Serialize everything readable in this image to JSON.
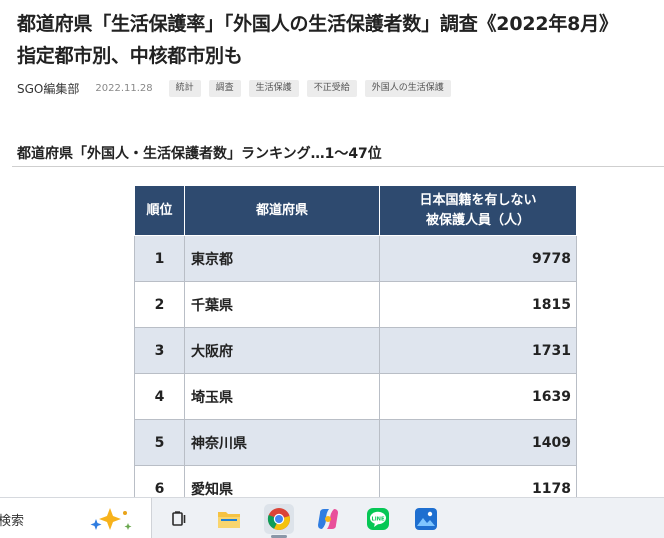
{
  "article": {
    "title_line1": "都道府県「生活保護率」「外国人の生活保護者数」調査《2022年8月》",
    "title_line2": "指定都市別、中核都市別も",
    "author": "SGO編集部",
    "date": "2022.11.28",
    "tags": [
      "統計",
      "調査",
      "生活保護",
      "不正受給",
      "外国人の生活保護"
    ]
  },
  "section": {
    "title": "都道府県「外国人・生活保護者数」ランキング…1〜47位"
  },
  "table": {
    "headers": {
      "rank": "順位",
      "prefecture": "都道府県",
      "count_line1": "日本国籍を有しない",
      "count_line2": "被保護人員（人）"
    },
    "rows": [
      {
        "rank": "1",
        "prefecture": "東京都",
        "count": "9778"
      },
      {
        "rank": "2",
        "prefecture": "千葉県",
        "count": "1815"
      },
      {
        "rank": "3",
        "prefecture": "大阪府",
        "count": "1731"
      },
      {
        "rank": "4",
        "prefecture": "埼玉県",
        "count": "1639"
      },
      {
        "rank": "5",
        "prefecture": "神奈川県",
        "count": "1409"
      },
      {
        "rank": "6",
        "prefecture": "愛知県",
        "count": "1178"
      }
    ]
  },
  "taskbar": {
    "search_label": "検索",
    "icons": [
      "copilot-sparkle-icon",
      "task-view-icon",
      "file-explorer-icon",
      "chrome-icon",
      "copilot-app-icon",
      "line-app-icon",
      "photos-app-icon"
    ],
    "colors": {
      "line_green": "#06c755",
      "header_navy": "#2e4a6f",
      "row_tint": "#dfe5ee"
    }
  }
}
